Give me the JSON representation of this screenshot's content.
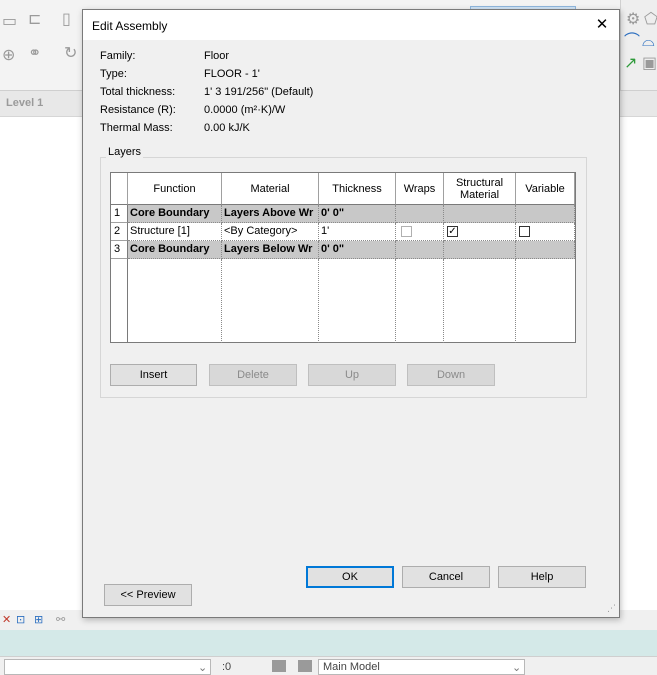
{
  "background": {
    "level_label": "Level 1",
    "status_counter": ":0",
    "status_model": "Main Model"
  },
  "dialog": {
    "title": "Edit Assembly",
    "close_glyph": "✕",
    "properties": [
      {
        "label": "Family:",
        "value": "Floor"
      },
      {
        "label": "Type:",
        "value": "FLOOR - 1'"
      },
      {
        "label": "Total thickness:",
        "value": "1'  3 191/256\" (Default)"
      },
      {
        "label": "Resistance (R):",
        "value": "0.0000 (m²·K)/W"
      },
      {
        "label": "Thermal Mass:",
        "value": "0.00 kJ/K"
      }
    ],
    "layers_group_label": "Layers",
    "table": {
      "columns": [
        "Function",
        "Material",
        "Thickness",
        "Wraps",
        "Structural Material",
        "Variable"
      ],
      "rows": [
        {
          "num": "1",
          "function": "Core Boundary",
          "material": "Layers Above Wr",
          "thickness": "0'  0\"",
          "style": "boundary"
        },
        {
          "num": "2",
          "function": "Structure [1]",
          "material": "<By Category>",
          "thickness": "1'",
          "wraps": false,
          "structural": true,
          "variable": false
        },
        {
          "num": "3",
          "function": "Core Boundary",
          "material": "Layers Below Wr",
          "thickness": "0'  0\"",
          "style": "boundary"
        }
      ]
    },
    "layer_buttons": {
      "insert": "Insert",
      "delete": "Delete",
      "up": "Up",
      "down": "Down"
    },
    "footer_buttons": {
      "ok": "OK",
      "cancel": "Cancel",
      "help": "Help",
      "preview": "<< Preview"
    },
    "check_glyph": "✓"
  },
  "colors": {
    "accent": "#0078d7",
    "boundary_row": "#c8c8c8",
    "dialog_bg": "#f0f0f0"
  }
}
